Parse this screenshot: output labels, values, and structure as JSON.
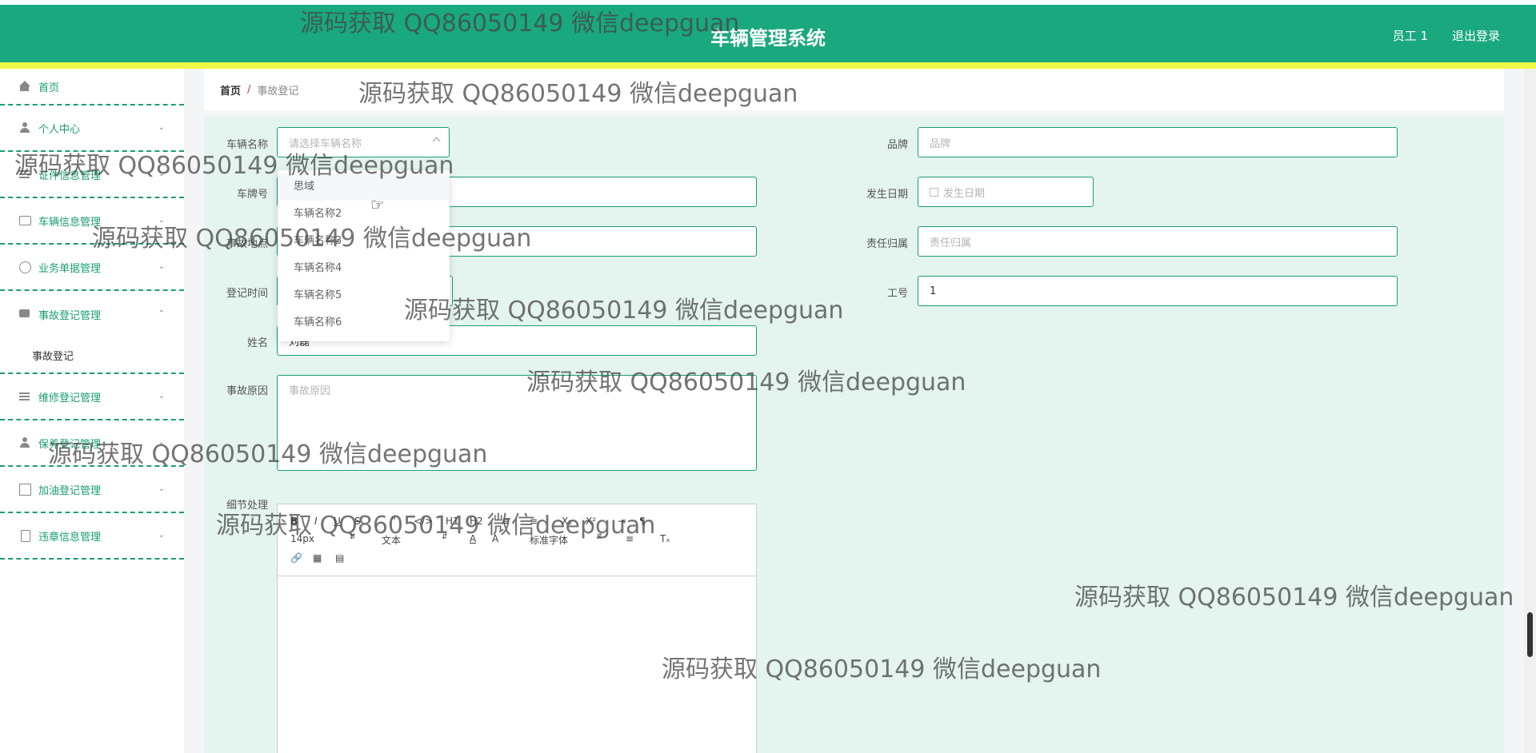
{
  "header": {
    "title": "车辆管理系统",
    "user": "员工 1",
    "logout": "退出登录"
  },
  "sidebar": {
    "items": [
      {
        "label": "首页",
        "icon": "home-icon"
      },
      {
        "label": "个人中心",
        "icon": "person-icon"
      },
      {
        "label": "证件信息管理",
        "icon": "list-icon"
      },
      {
        "label": "车辆信息管理",
        "icon": "chat-icon"
      },
      {
        "label": "业务单据管理",
        "icon": "gauge-icon"
      },
      {
        "label": "事故登记管理",
        "icon": "message-icon"
      },
      {
        "label": "维修登记管理",
        "icon": "bars-icon"
      },
      {
        "label": "保养登记管理",
        "icon": "person-icon"
      },
      {
        "label": "加油登记管理",
        "icon": "chart-icon"
      },
      {
        "label": "违章信息管理",
        "icon": "clipboard-icon"
      }
    ],
    "submenu_label": "事故登记"
  },
  "breadcrumb": {
    "home": "首页",
    "sep": "/",
    "current": "事故登记"
  },
  "form": {
    "vehicle_name_label": "车辆名称",
    "vehicle_name_placeholder": "请选择车辆名称",
    "brand_label": "品牌",
    "brand_placeholder": "品牌",
    "plate_label": "车牌号",
    "date_label": "发生日期",
    "date_placeholder": "发生日期",
    "location_label": "事故地点",
    "responsibility_label": "责任归属",
    "responsibility_placeholder": "责任归属",
    "register_time_label": "登记时间",
    "job_no_label": "工号",
    "job_no_value": "1",
    "name_label": "姓名",
    "name_value": "刘磊",
    "cause_label": "事故原因",
    "cause_placeholder": "事故原因",
    "detail_label": "细节处理"
  },
  "dropdown": {
    "options": [
      "思域",
      "车辆名称2",
      "车辆名称3",
      "车辆名称4",
      "车辆名称5",
      "车辆名称6"
    ]
  },
  "editor": {
    "font_size": "14px",
    "text_style": "文本",
    "font_family": "标准字体"
  },
  "watermark": "源码获取 QQ86050149 微信deepguan"
}
